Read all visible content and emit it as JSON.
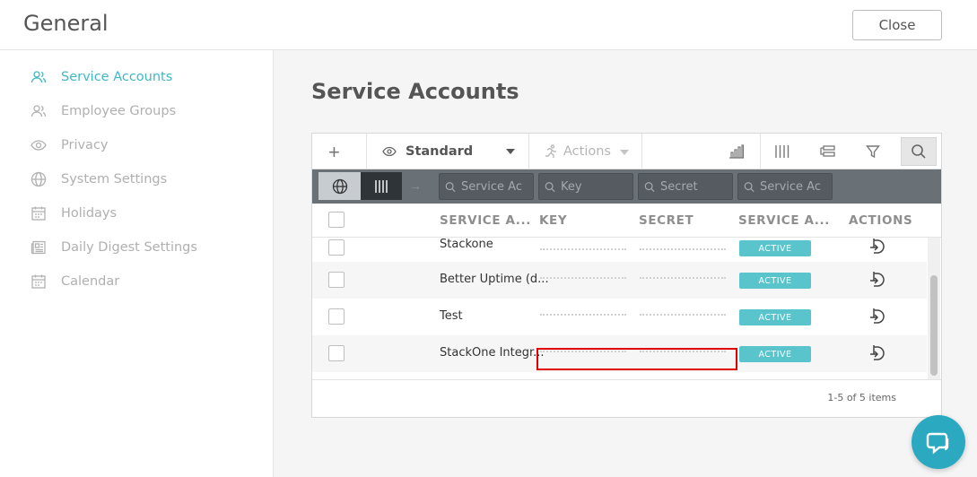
{
  "header": {
    "title": "General",
    "close_label": "Close"
  },
  "sidebar": {
    "items": [
      {
        "label": "Service Accounts",
        "icon": "users-icon",
        "active": true
      },
      {
        "label": "Employee Groups",
        "icon": "users-icon",
        "active": false
      },
      {
        "label": "Privacy",
        "icon": "eye-icon",
        "active": false
      },
      {
        "label": "System Settings",
        "icon": "globe-icon",
        "active": false
      },
      {
        "label": "Holidays",
        "icon": "calendar-icon",
        "active": false
      },
      {
        "label": "Daily Digest Settings",
        "icon": "newspaper-icon",
        "active": false
      },
      {
        "label": "Calendar",
        "icon": "calendar-icon",
        "active": false
      }
    ]
  },
  "main": {
    "page_title": "Service Accounts",
    "toolbar": {
      "add_icon": "+",
      "view_label": "Standard",
      "actions_label": "Actions"
    },
    "filters": {
      "arrow": "→",
      "service_account_placeholder": "Service Ac",
      "key_placeholder": "Key",
      "secret_placeholder": "Secret",
      "status_placeholder": "Service Ac"
    },
    "columns": [
      "SERVICE A...",
      "KEY",
      "SECRET",
      "SERVICE A...",
      "ACTIONS"
    ],
    "rows": [
      {
        "name": "Stackone",
        "status": "ACTIVE"
      },
      {
        "name": "Better Uptime (d...",
        "status": "ACTIVE"
      },
      {
        "name": "Test",
        "status": "ACTIVE"
      },
      {
        "name": "StackOne Integr...",
        "status": "ACTIVE"
      }
    ],
    "pager": "1-5 of 5 items"
  },
  "colors": {
    "accent": "#3fb8c4",
    "status_active": "#5ac4cd",
    "highlight": "#e00000",
    "chat": "#2aa9c1"
  }
}
